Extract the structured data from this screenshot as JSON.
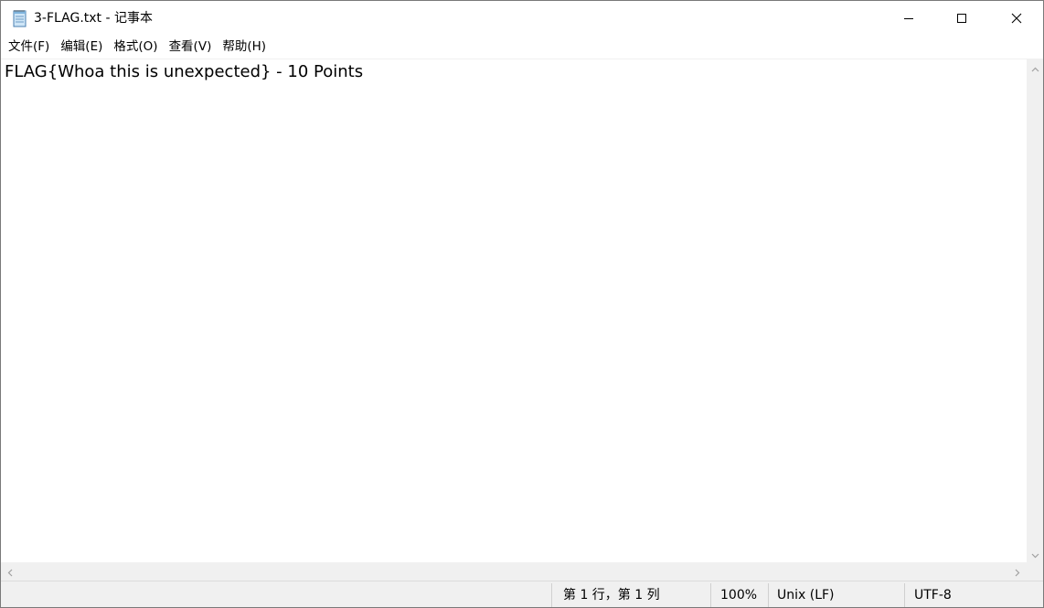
{
  "window": {
    "title": "3-FLAG.txt - 记事本",
    "app_icon": "notepad-icon",
    "controls": {
      "minimize_icon": "minimize-icon",
      "maximize_icon": "maximize-icon",
      "close_icon": "close-icon"
    }
  },
  "menu": {
    "items": [
      {
        "label": "文件(F)"
      },
      {
        "label": "编辑(E)"
      },
      {
        "label": "格式(O)"
      },
      {
        "label": "查看(V)"
      },
      {
        "label": "帮助(H)"
      }
    ]
  },
  "editor": {
    "content": "FLAG{Whoa this is unexpected} - 10 Points"
  },
  "status": {
    "position": "第 1 行，第 1 列",
    "zoom": "100%",
    "line_ending": "Unix (LF)",
    "encoding": "UTF-8"
  },
  "colors": {
    "chrome": "#f0f0f0",
    "border": "#7a7a7a",
    "text": "#000000"
  }
}
